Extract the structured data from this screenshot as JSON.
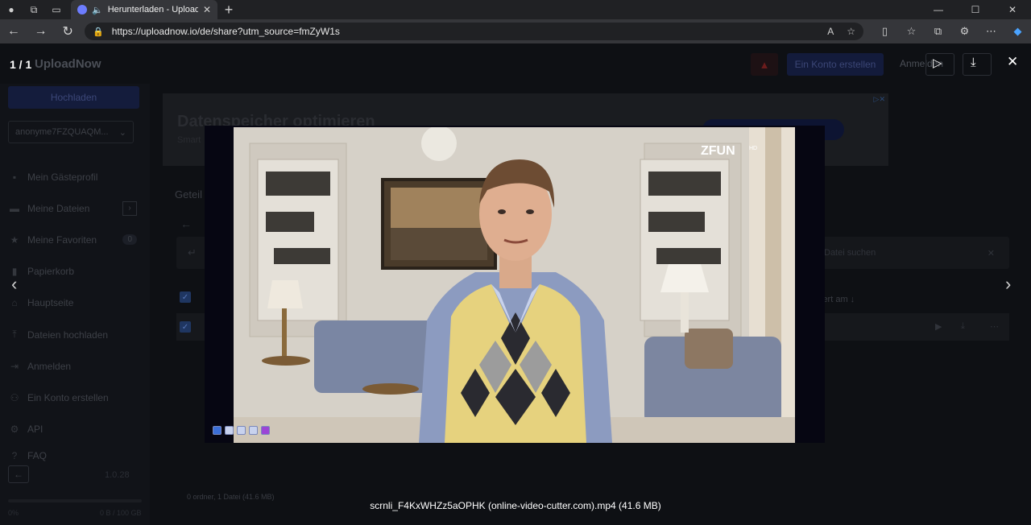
{
  "browser": {
    "tab_title": "Herunterladen - UploadNow",
    "url": "https://uploadnow.io/de/share?utm_source=fmZyW1s"
  },
  "viewer": {
    "counter": "1 / 1",
    "caption": "scrnli_F4KxWHZz5aOPHK (online-video-cutter.com).mp4  (41.6 MB)",
    "video_channel_logo": "ZFUN",
    "video_channel_suffix": "HD"
  },
  "app": {
    "logo": "UploadNow",
    "signup_button": "Ein Konto erstellen",
    "login_button": "Anmelden",
    "upload_button": "Hochladen",
    "user_select": "anonyme7FZQUAQM..."
  },
  "sidebar": {
    "items": [
      {
        "label": "Mein Gästeprofil",
        "icon": "user-icon"
      },
      {
        "label": "Meine Dateien",
        "icon": "folder-icon"
      },
      {
        "label": "Meine Favoriten",
        "icon": "star-icon",
        "badge": "0"
      },
      {
        "label": "Papierkorb",
        "icon": "trash-icon"
      },
      {
        "label": "Hauptseite",
        "icon": "home-icon"
      },
      {
        "label": "Dateien hochladen",
        "icon": "upload-icon"
      },
      {
        "label": "Anmelden",
        "icon": "login-icon"
      },
      {
        "label": "Ein Konto erstellen",
        "icon": "add-user-icon"
      },
      {
        "label": "API",
        "icon": "gear-icon"
      },
      {
        "label": "FAQ",
        "icon": "help-icon"
      }
    ],
    "version": "1.0.28",
    "quota_percent": "0%",
    "quota_text": "0 B / 100 GB"
  },
  "ad": {
    "title": "Datenspeicher optimieren",
    "subtitle": "Smart"
  },
  "content": {
    "section_title": "Geteil",
    "search_placeholder": "Datei suchen",
    "sort_label": "lert am ↓",
    "footer_count": "0 ordner, 1 Datei (41.6 MB)"
  }
}
